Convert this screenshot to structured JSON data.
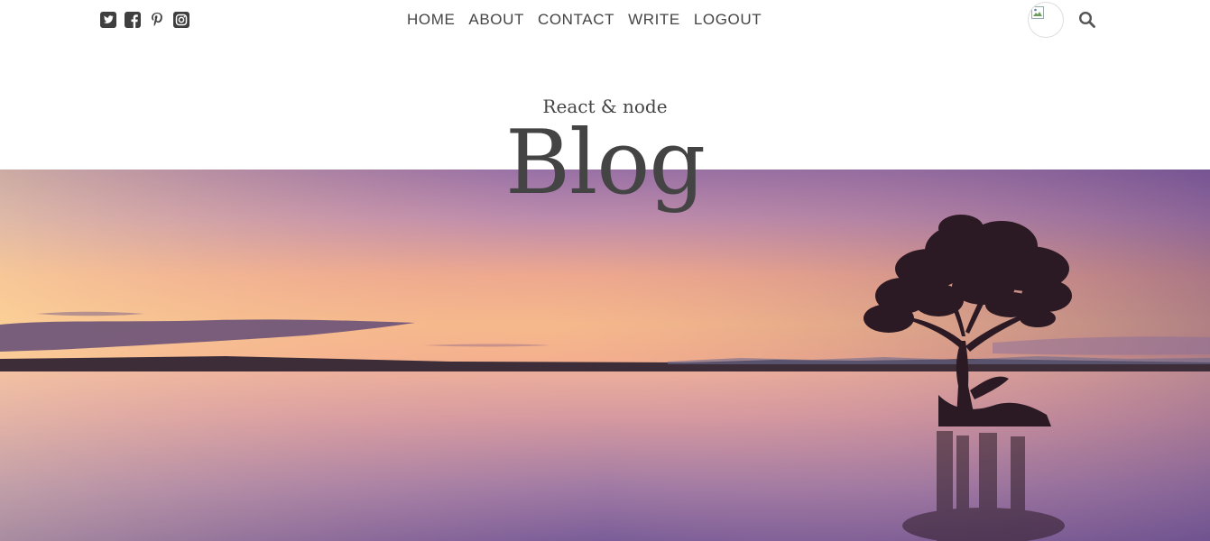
{
  "header": {
    "subtitle": "React & node",
    "title": "Blog"
  },
  "social": [
    {
      "name": "twitter-icon"
    },
    {
      "name": "facebook-icon"
    },
    {
      "name": "pinterest-icon"
    },
    {
      "name": "instagram-icon"
    }
  ],
  "nav": {
    "home": "HOME",
    "about": "ABOUT",
    "contact": "CONTACT",
    "write": "WRITE",
    "logout": "LOGOUT"
  },
  "colors": {
    "text": "#444444",
    "sky_top": "#6a4f8f",
    "sky_horizon": "#f3b48e",
    "water": "#7d5d95"
  }
}
